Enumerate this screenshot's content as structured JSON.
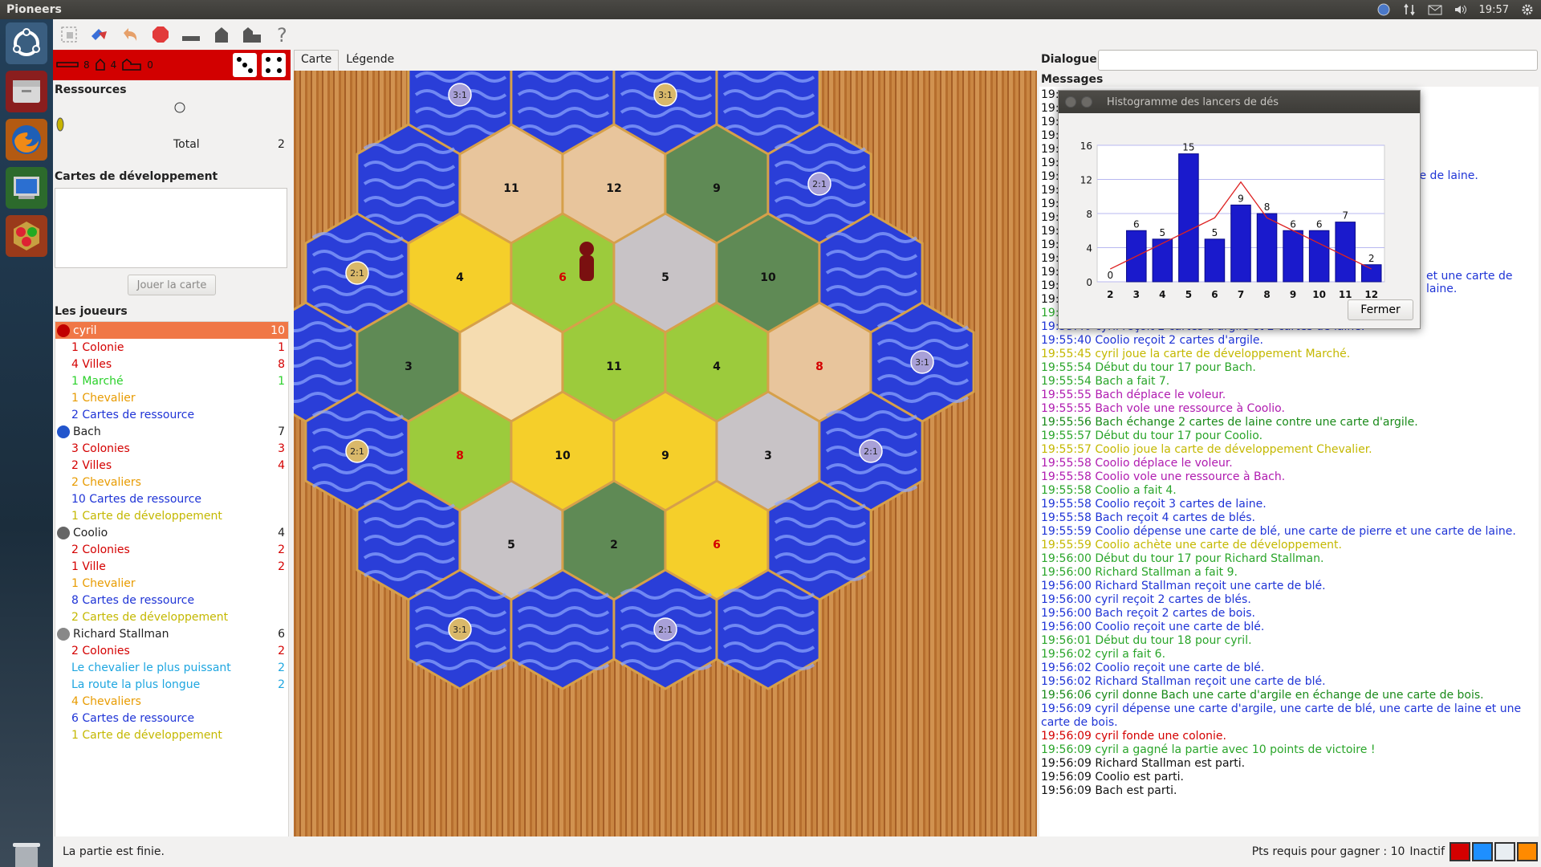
{
  "window": {
    "title": "Pioneers"
  },
  "system": {
    "clock": "19:57"
  },
  "left": {
    "counts": {
      "roads": "8",
      "settlements": "4",
      "cities": "0"
    },
    "resources_title": "Ressources",
    "total_label": "Total",
    "total_value": "2",
    "dev_cards_title": "Cartes de développement",
    "play_card_button": "Jouer la carte",
    "players_title": "Les joueurs",
    "players": [
      {
        "name": "cyril",
        "score": "10",
        "color": "#c00000",
        "selected": true,
        "rows": [
          {
            "label": "1 Colonie",
            "value": "1",
            "color": "#d40000"
          },
          {
            "label": "4 Villes",
            "value": "8",
            "color": "#d40000"
          },
          {
            "label": "1 Marché",
            "value": "1",
            "color": "#2bd12b"
          },
          {
            "label": "1 Chevalier",
            "value": "",
            "color": "#e89b00"
          },
          {
            "label": "2 Cartes de ressource",
            "value": "",
            "color": "#1f34d6"
          }
        ]
      },
      {
        "name": "Bach",
        "score": "7",
        "color": "#2255cc",
        "selected": false,
        "rows": [
          {
            "label": "3 Colonies",
            "value": "3",
            "color": "#d40000"
          },
          {
            "label": "2 Villes",
            "value": "4",
            "color": "#d40000"
          },
          {
            "label": "2 Chevaliers",
            "value": "",
            "color": "#e89b00"
          },
          {
            "label": "10 Cartes de ressource",
            "value": "",
            "color": "#1f34d6"
          },
          {
            "label": "1 Carte de développement",
            "value": "",
            "color": "#c4b800"
          }
        ]
      },
      {
        "name": "Coolio",
        "score": "4",
        "color": "#666666",
        "selected": false,
        "rows": [
          {
            "label": "2 Colonies",
            "value": "2",
            "color": "#d40000"
          },
          {
            "label": "1 Ville",
            "value": "2",
            "color": "#d40000"
          },
          {
            "label": "1 Chevalier",
            "value": "",
            "color": "#e89b00"
          },
          {
            "label": "8 Cartes de ressource",
            "value": "",
            "color": "#1f34d6"
          },
          {
            "label": "2 Cartes de développement",
            "value": "",
            "color": "#c4b800"
          }
        ]
      },
      {
        "name": "Richard Stallman",
        "score": "6",
        "color": "#888888",
        "selected": false,
        "rows": [
          {
            "label": "2 Colonies",
            "value": "2",
            "color": "#d40000"
          },
          {
            "label": "Le chevalier le plus puissant",
            "value": "2",
            "color": "#1ea6e0"
          },
          {
            "label": "La route la plus longue",
            "value": "2",
            "color": "#1ea6e0"
          },
          {
            "label": "4 Chevaliers",
            "value": "",
            "color": "#e89b00"
          },
          {
            "label": "6 Cartes de ressource",
            "value": "",
            "color": "#1f34d6"
          },
          {
            "label": "1 Carte de développement",
            "value": "",
            "color": "#c4b800"
          }
        ]
      }
    ]
  },
  "map": {
    "tabs": [
      "Carte",
      "Légende"
    ],
    "numbers": {
      "r1": [
        "11",
        "12",
        "9"
      ],
      "r2": [
        "4",
        "6",
        "5",
        "10"
      ],
      "r3": [
        "3",
        "11",
        "4",
        "8"
      ],
      "r4": [
        "8",
        "10",
        "9",
        "3"
      ],
      "r5": [
        "5",
        "2",
        "6"
      ]
    },
    "ports": [
      "3:1",
      "3:1",
      "2:1",
      "2:1",
      "3:1",
      "2:1",
      "2:1",
      "3:1",
      "2:1"
    ]
  },
  "right": {
    "dialogue_label": "Dialogue",
    "messages_label": "Messages",
    "messages": [
      {
        "text": "19:",
        "color": "#111"
      },
      {
        "text": "19:",
        "color": "#111"
      },
      {
        "text": "19:",
        "color": "#111"
      },
      {
        "text": "19:",
        "color": "#111"
      },
      {
        "text": "19:",
        "color": "#111"
      },
      {
        "text": "19:",
        "color": "#111"
      },
      {
        "text": "19:",
        "color": "#111"
      },
      {
        "text": "19:",
        "color": "#111"
      },
      {
        "text": "19:",
        "color": "#111"
      },
      {
        "text": "19:",
        "color": "#111"
      },
      {
        "text": "19:",
        "color": "#111"
      },
      {
        "text": "19:",
        "color": "#111"
      },
      {
        "text": "19:",
        "color": "#111"
      },
      {
        "text": "19:",
        "color": "#111"
      },
      {
        "text": "19:",
        "color": "#111"
      },
      {
        "text": "19:",
        "color": "#111"
      },
      {
        "text": "19:55:40 cyril a fait 8.",
        "color": "#2aa52a"
      },
      {
        "text": "19:55:40 cyril reçoit 2 cartes d'argile et 2 cartes de laine.",
        "color": "#1f34d6"
      },
      {
        "text": "19:55:40 Coolio reçoit 2 cartes d'argile.",
        "color": "#1f34d6"
      },
      {
        "text": "19:55:45 cyril joue la carte de développement Marché.",
        "color": "#c4b800"
      },
      {
        "text": "19:55:54 Début du tour 17 pour Bach.",
        "color": "#2aa52a"
      },
      {
        "text": "19:55:54 Bach a fait 7.",
        "color": "#2aa52a"
      },
      {
        "text": "19:55:55 Bach déplace le voleur.",
        "color": "#b01cb0"
      },
      {
        "text": "19:55:55 Bach vole une ressource à Coolio.",
        "color": "#b01cb0"
      },
      {
        "text": "19:55:56 Bach échange 2 cartes de laine contre une carte d'argile.",
        "color": "#1a8a1a"
      },
      {
        "text": "19:55:57 Début du tour 17 pour Coolio.",
        "color": "#2aa52a"
      },
      {
        "text": "19:55:57 Coolio joue la carte de développement Chevalier.",
        "color": "#c4b800"
      },
      {
        "text": "19:55:58 Coolio déplace le voleur.",
        "color": "#b01cb0"
      },
      {
        "text": "19:55:58 Coolio vole une ressource à Bach.",
        "color": "#b01cb0"
      },
      {
        "text": "19:55:58 Coolio a fait 4.",
        "color": "#2aa52a"
      },
      {
        "text": "19:55:58 Coolio reçoit 3 cartes de laine.",
        "color": "#1f34d6"
      },
      {
        "text": "19:55:58 Bach reçoit 4 cartes de blés.",
        "color": "#1f34d6"
      },
      {
        "text": "19:55:59 Coolio dépense une carte de blé, une carte de pierre et une carte de laine.",
        "color": "#1f34d6"
      },
      {
        "text": "19:55:59 Coolio achète une carte de développement.",
        "color": "#c4b800"
      },
      {
        "text": "19:56:00 Début du tour 17 pour Richard Stallman.",
        "color": "#2aa52a"
      },
      {
        "text": "19:56:00 Richard Stallman a fait 9.",
        "color": "#2aa52a"
      },
      {
        "text": "19:56:00 Richard Stallman reçoit une carte de blé.",
        "color": "#1f34d6"
      },
      {
        "text": "19:56:00 cyril reçoit 2 cartes de blés.",
        "color": "#1f34d6"
      },
      {
        "text": "19:56:00 Bach reçoit 2 cartes de bois.",
        "color": "#1f34d6"
      },
      {
        "text": "19:56:00 Coolio reçoit une carte de blé.",
        "color": "#1f34d6"
      },
      {
        "text": "19:56:01 Début du tour 18 pour cyril.",
        "color": "#2aa52a"
      },
      {
        "text": "19:56:02 cyril a fait 6.",
        "color": "#2aa52a"
      },
      {
        "text": "19:56:02 Coolio reçoit une carte de blé.",
        "color": "#1f34d6"
      },
      {
        "text": "19:56:02 Richard Stallman reçoit une carte de blé.",
        "color": "#1f34d6"
      },
      {
        "text": "19:56:06 cyril donne Bach une carte d'argile en échange de une carte de bois.",
        "color": "#1a8a1a"
      },
      {
        "text": "19:56:09 cyril dépense une carte d'argile, une carte de blé, une carte de laine et une carte de bois.",
        "color": "#1f34d6"
      },
      {
        "text": "19:56:09 cyril fonde une colonie.",
        "color": "#d40000"
      },
      {
        "text": "19:56:09 cyril a gagné la partie avec 10 points de victoire !",
        "color": "#2aa52a"
      },
      {
        "text": "19:56:09 Richard Stallman est parti.",
        "color": "#111"
      },
      {
        "text": "19:56:09 Coolio est parti.",
        "color": "#111"
      },
      {
        "text": "19:56:09 Bach est parti.",
        "color": "#111"
      }
    ],
    "hidden_fragments": [
      "te de laine.",
      "et une carte de laine."
    ]
  },
  "histogram": {
    "title": "Histogramme des lancers de dés",
    "close_button": "Fermer",
    "chart_data": {
      "type": "bar",
      "categories": [
        "2",
        "3",
        "4",
        "5",
        "6",
        "7",
        "8",
        "9",
        "10",
        "11",
        "12"
      ],
      "values": [
        0,
        6,
        5,
        15,
        5,
        9,
        8,
        6,
        6,
        7,
        2
      ],
      "expected": [
        1.5,
        3.0,
        4.5,
        6.0,
        7.5,
        11.7,
        7.5,
        6.0,
        4.5,
        3.0,
        1.5
      ],
      "yticks": [
        0,
        4,
        8,
        12,
        16
      ],
      "ylim": [
        0,
        16
      ],
      "bar_color": "#1a1acc",
      "line_color": "#dd2222"
    }
  },
  "status": {
    "message": "La partie est finie.",
    "points_required": "Pts requis pour gagner : 10",
    "state": "Inactif",
    "player_colors": [
      "#d40000",
      "#1e8fff",
      "#e8eef2",
      "#ff8a00"
    ]
  }
}
